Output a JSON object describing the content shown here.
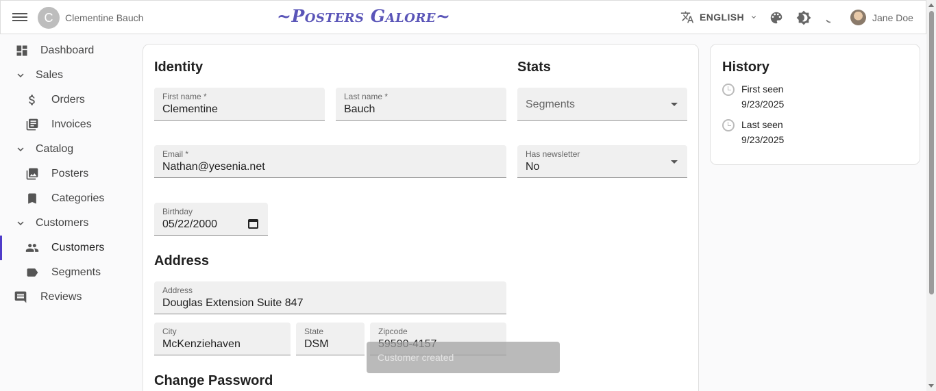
{
  "appbar": {
    "user_initial": "C",
    "user_name": "Clementine Bauch",
    "brand": "~Posters Galore~",
    "language": "ENGLISH",
    "account_name": "Jane Doe"
  },
  "sidebar": {
    "dashboard": "Dashboard",
    "sales": "Sales",
    "orders": "Orders",
    "invoices": "Invoices",
    "catalog": "Catalog",
    "posters": "Posters",
    "categories": "Categories",
    "customers_group": "Customers",
    "customers": "Customers",
    "segments": "Segments",
    "reviews": "Reviews"
  },
  "form": {
    "identity_title": "Identity",
    "stats_title": "Stats",
    "first_name": {
      "label": "First name *",
      "value": "Clementine"
    },
    "last_name": {
      "label": "Last name *",
      "value": "Bauch"
    },
    "segments": {
      "placeholder": "Segments"
    },
    "email": {
      "label": "Email *",
      "value": "Nathan@yesenia.net"
    },
    "newsletter": {
      "label": "Has newsletter",
      "value": "No"
    },
    "birthday": {
      "label": "Birthday",
      "value": "05/22/2000"
    },
    "address_title": "Address",
    "address": {
      "label": "Address",
      "value": "Douglas Extension Suite 847"
    },
    "city": {
      "label": "City",
      "value": "McKenziehaven"
    },
    "state": {
      "label": "State",
      "value": "DSM"
    },
    "zipcode": {
      "label": "Zipcode",
      "value": "59590-4157"
    },
    "password_title": "Change Password"
  },
  "history": {
    "title": "History",
    "first_seen_label": "First seen",
    "first_seen_date": "9/23/2025",
    "last_seen_label": "Last seen",
    "last_seen_date": "9/23/2025"
  },
  "snackbar": {
    "message": "Customer created"
  },
  "colors": {
    "accent": "#4f3cc9",
    "brand": "#5a55b8"
  }
}
